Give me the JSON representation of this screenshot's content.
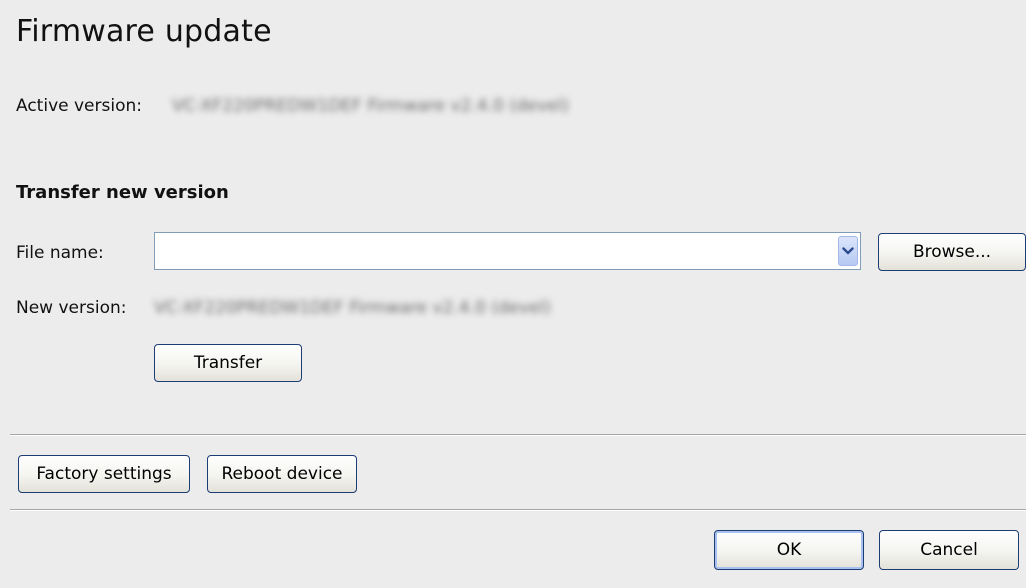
{
  "dialog": {
    "title": "Firmware update",
    "active_version_label": "Active version:",
    "active_version_value": "VC-XF220PREDW1DEF Firmware v2.4.0 (devel)",
    "section_heading": "Transfer new version",
    "file_name_label": "File name:",
    "file_name_value": "",
    "file_name_placeholder": "",
    "browse_label": "Browse...",
    "new_version_label": "New version:",
    "new_version_value": "VC-XF220PREDW1DEF Firmware v2.4.0 (devel)",
    "transfer_label": "Transfer",
    "factory_settings_label": "Factory settings",
    "reboot_device_label": "Reboot device",
    "ok_label": "OK",
    "cancel_label": "Cancel"
  },
  "icons": {
    "dropdown": "chevron-down-icon"
  },
  "colors": {
    "background": "#ececec",
    "button_border": "#1c3c74",
    "combo_border": "#7f9db9",
    "arrow_fill": "#b6c9f3"
  }
}
